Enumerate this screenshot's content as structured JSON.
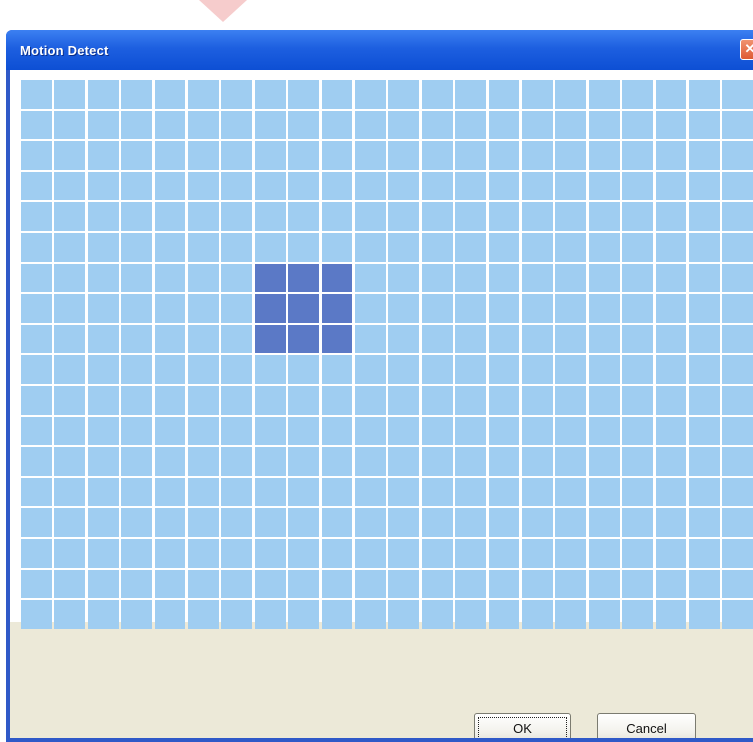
{
  "window": {
    "title": "Motion Detect",
    "close_glyph": "✕",
    "close_icon": "close-icon"
  },
  "grid": {
    "columns": 22,
    "rows": 18,
    "selected_cells": [
      [
        6,
        7
      ],
      [
        6,
        8
      ],
      [
        6,
        9
      ],
      [
        7,
        7
      ],
      [
        7,
        8
      ],
      [
        7,
        9
      ],
      [
        8,
        7
      ],
      [
        8,
        8
      ],
      [
        8,
        9
      ]
    ],
    "colors": {
      "cell": "#9fcdf1",
      "selected_cell": "#5b79c6",
      "gridline": "#ffffff"
    }
  },
  "buttons": {
    "ok_label": "OK",
    "cancel_label": "Cancel"
  }
}
